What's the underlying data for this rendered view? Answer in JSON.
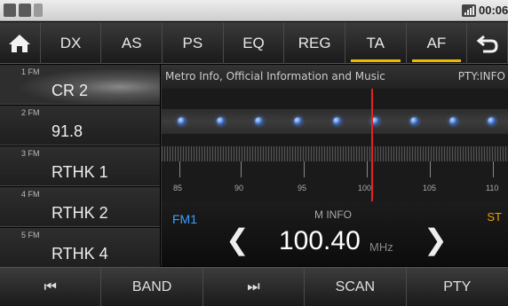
{
  "status_bar": {
    "icons": [
      "usb-icon",
      "bag-icon",
      "bluetooth-icon",
      "signal-icon"
    ],
    "time": "00:06"
  },
  "tabs": [
    {
      "label": "DX"
    },
    {
      "label": "AS"
    },
    {
      "label": "PS"
    },
    {
      "label": "EQ"
    },
    {
      "label": "REG"
    },
    {
      "label": "TA"
    },
    {
      "label": "AF"
    }
  ],
  "active_tabs": [
    "TA",
    "AF"
  ],
  "presets": [
    {
      "number": "1 FM",
      "name": "CR 2"
    },
    {
      "number": "2 FM",
      "name": "91.8"
    },
    {
      "number": "3 FM",
      "name": "RTHK 1"
    },
    {
      "number": "4 FM",
      "name": "RTHK 2"
    },
    {
      "number": "5 FM",
      "name": "RTHK 4"
    }
  ],
  "selected_preset": 1,
  "rds": {
    "text": "Metro Info, Official Information and Music",
    "pty": "PTY:INFO"
  },
  "scale_labels": [
    "85",
    "90",
    "95",
    "100",
    "105",
    "110"
  ],
  "tuner": {
    "band": "FM1",
    "station_info": "M INFO",
    "stereo": "ST",
    "frequency": "100.40",
    "unit": "MHz"
  },
  "bottom_buttons": [
    {
      "label": "⏮",
      "icon": "previous-icon"
    },
    {
      "label": "BAND"
    },
    {
      "label": "⏭",
      "icon": "next-icon"
    },
    {
      "label": "SCAN"
    },
    {
      "label": "PTY"
    }
  ],
  "colors": {
    "accent": "#f0b800",
    "needle": "#e52222",
    "band": "#3aa0ff",
    "stereo": "#f0a000"
  }
}
